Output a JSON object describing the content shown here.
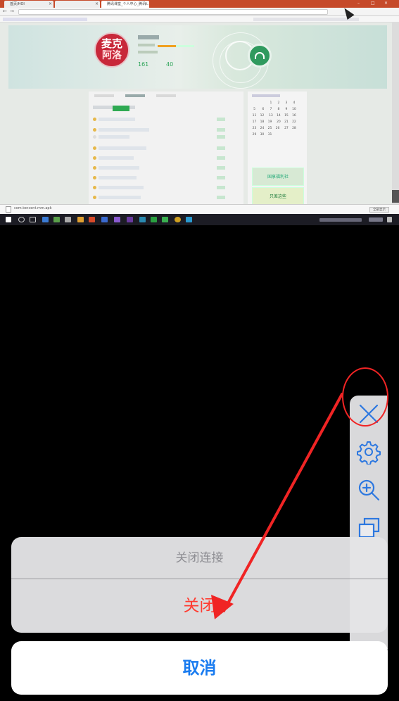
{
  "remote_screen": {
    "tabs": [
      "首页/HOI",
      "",
      "",
      "腾讯课堂_个人中心_腾讯..."
    ],
    "profile": {
      "logo_line1": "麦克",
      "logo_line2": "阿洛",
      "stat_1_value": "161",
      "stat_2_value": "40"
    },
    "download_file": "com.tencent.mm.apk",
    "download_button": "全部显示",
    "calendar_days": [
      "1",
      "2",
      "3",
      "4",
      "5",
      "6",
      "7",
      "8",
      "9",
      "10",
      "11",
      "12",
      "13",
      "14",
      "15",
      "16",
      "17",
      "18",
      "19",
      "20",
      "21",
      "22",
      "23",
      "24",
      "25",
      "26",
      "27",
      "28",
      "29",
      "30",
      "31"
    ],
    "ad_1": "国享福利社",
    "ad_2": "只差这些"
  },
  "action_sheet": {
    "title": "关闭连接",
    "close_label": "关闭",
    "cancel_label": "取消"
  },
  "toolbar": {
    "items": [
      "close-icon",
      "gear-icon",
      "zoom-in-icon",
      "window-icon"
    ]
  },
  "colors": {
    "annotation_red": "#f02424",
    "destructive_red": "#ff3b30",
    "cancel_blue": "#1a7cf0",
    "brand_green": "#2fa55a"
  }
}
